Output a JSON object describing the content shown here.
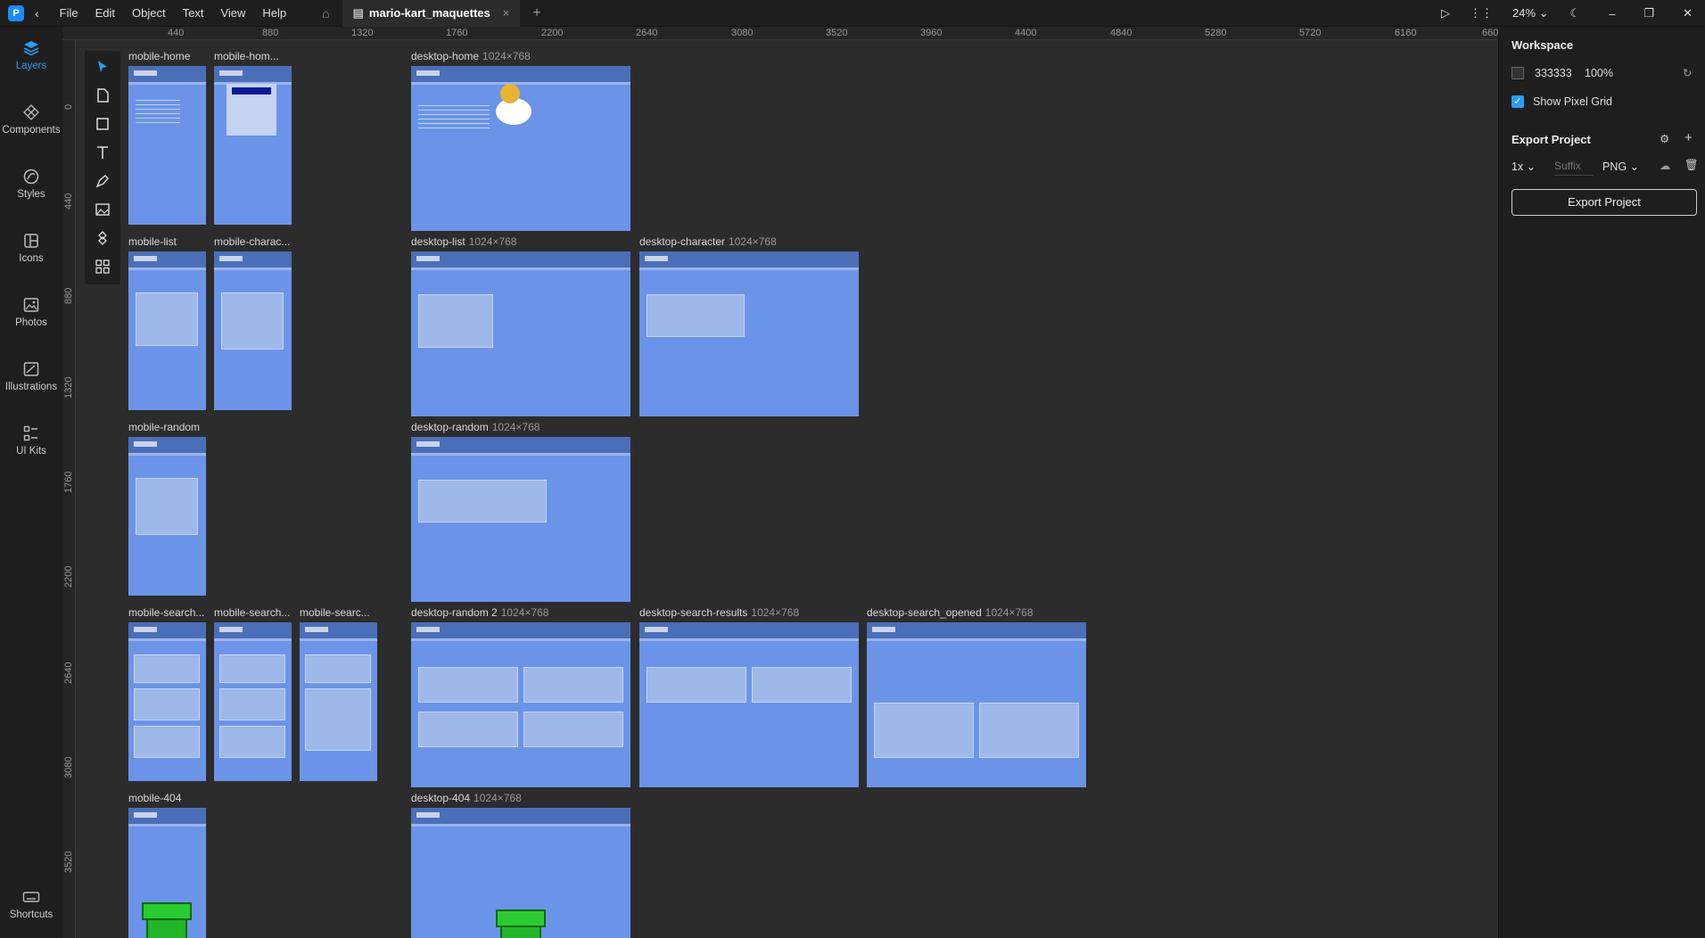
{
  "menu": [
    "File",
    "Edit",
    "Object",
    "Text",
    "View",
    "Help"
  ],
  "tab": {
    "title": "mario-kart_maquettes",
    "close": "×"
  },
  "zoom": "24%",
  "leftnav": [
    "Layers",
    "Components",
    "Styles",
    "Icons",
    "Photos",
    "Illustrations",
    "UI Kits"
  ],
  "shortcuts": "Shortcuts",
  "ruler_top": [
    "440",
    "880",
    "1320",
    "1760",
    "2200",
    "2640",
    "3080",
    "3520",
    "3960",
    "4400",
    "4840",
    "5280",
    "5720",
    "6160",
    "660"
  ],
  "ruler_left": [
    "0",
    "440",
    "880",
    "1320",
    "1760",
    "2200",
    "2640",
    "3080",
    "3520"
  ],
  "boards": [
    {
      "name": "mobile-home",
      "dim": ""
    },
    {
      "name": "mobile-hom...",
      "dim": ""
    },
    {
      "name": "desktop-home",
      "dim": "1024×768"
    },
    {
      "name": "mobile-list",
      "dim": ""
    },
    {
      "name": "mobile-charac...",
      "dim": ""
    },
    {
      "name": "desktop-list",
      "dim": "1024×768"
    },
    {
      "name": "desktop-character",
      "dim": "1024×768"
    },
    {
      "name": "mobile-random",
      "dim": ""
    },
    {
      "name": "desktop-random",
      "dim": "1024×768"
    },
    {
      "name": "mobile-search...",
      "dim": ""
    },
    {
      "name": "mobile-search...",
      "dim": ""
    },
    {
      "name": "mobile-searc...",
      "dim": ""
    },
    {
      "name": "desktop-random 2",
      "dim": "1024×768"
    },
    {
      "name": "desktop-search-results",
      "dim": "1024×768"
    },
    {
      "name": "desktop-search_opened",
      "dim": "1024×768"
    },
    {
      "name": "mobile-404",
      "dim": ""
    },
    {
      "name": "desktop-404",
      "dim": "1024×768"
    }
  ],
  "rightpanel": {
    "workspace_title": "Workspace",
    "bg_color": "333333",
    "bg_opacity": "100%",
    "pixel_grid_label": "Show Pixel Grid",
    "export_title": "Export Project",
    "scale": "1x",
    "suffix_placeholder": "Suffix",
    "format": "PNG",
    "export_button": "Export Project"
  }
}
